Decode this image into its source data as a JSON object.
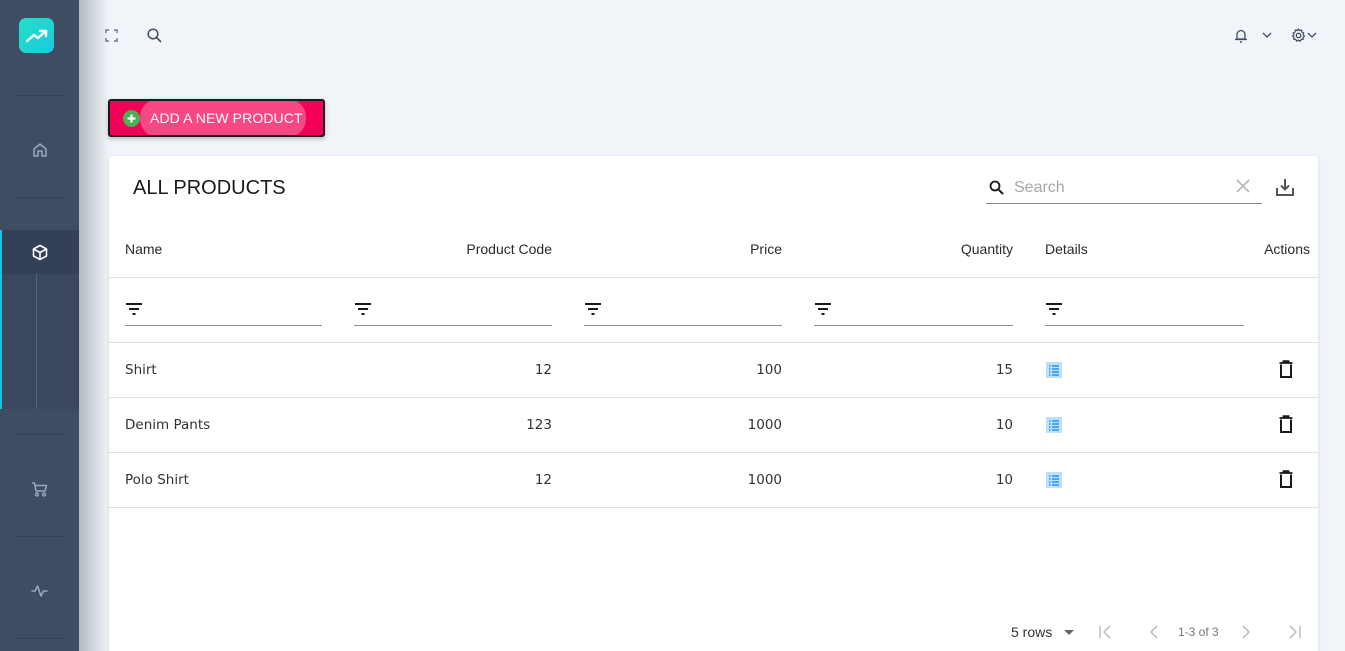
{
  "sidebar": {
    "logo": "trending-up-icon",
    "items": [
      {
        "name": "home",
        "icon": "home-icon",
        "active": false
      },
      {
        "name": "products",
        "icon": "cube-icon",
        "active": true
      },
      {
        "name": "orders",
        "icon": "cart-icon",
        "active": false
      },
      {
        "name": "activity",
        "icon": "activity-icon",
        "active": false
      }
    ],
    "accent_color": "#17c3e6"
  },
  "topbar": {
    "left_icons": [
      "fullscreen-icon",
      "search-icon"
    ],
    "right_icons": [
      "bell-icon",
      "chevron-down-icon",
      "gear-icon",
      "chevron-down-icon"
    ]
  },
  "add_button": {
    "label": "ADD A NEW PRODUCT",
    "icon": "plus-circle-icon",
    "color": "#f50057"
  },
  "table": {
    "title": "ALL PRODUCTS",
    "search": {
      "placeholder": "Search",
      "value": ""
    },
    "columns": [
      "Name",
      "Product Code",
      "Price",
      "Quantity",
      "Details",
      "Actions"
    ],
    "rows": [
      {
        "name": "Shirt",
        "product_code": "12",
        "price": "100",
        "quantity": "15"
      },
      {
        "name": "Denim Pants",
        "product_code": "123",
        "price": "1000",
        "quantity": "10"
      },
      {
        "name": "Polo Shirt",
        "product_code": "12",
        "price": "1000",
        "quantity": "10"
      }
    ],
    "pagination": {
      "rows_per_page": "5 rows",
      "range": "1-3 of 3"
    }
  }
}
